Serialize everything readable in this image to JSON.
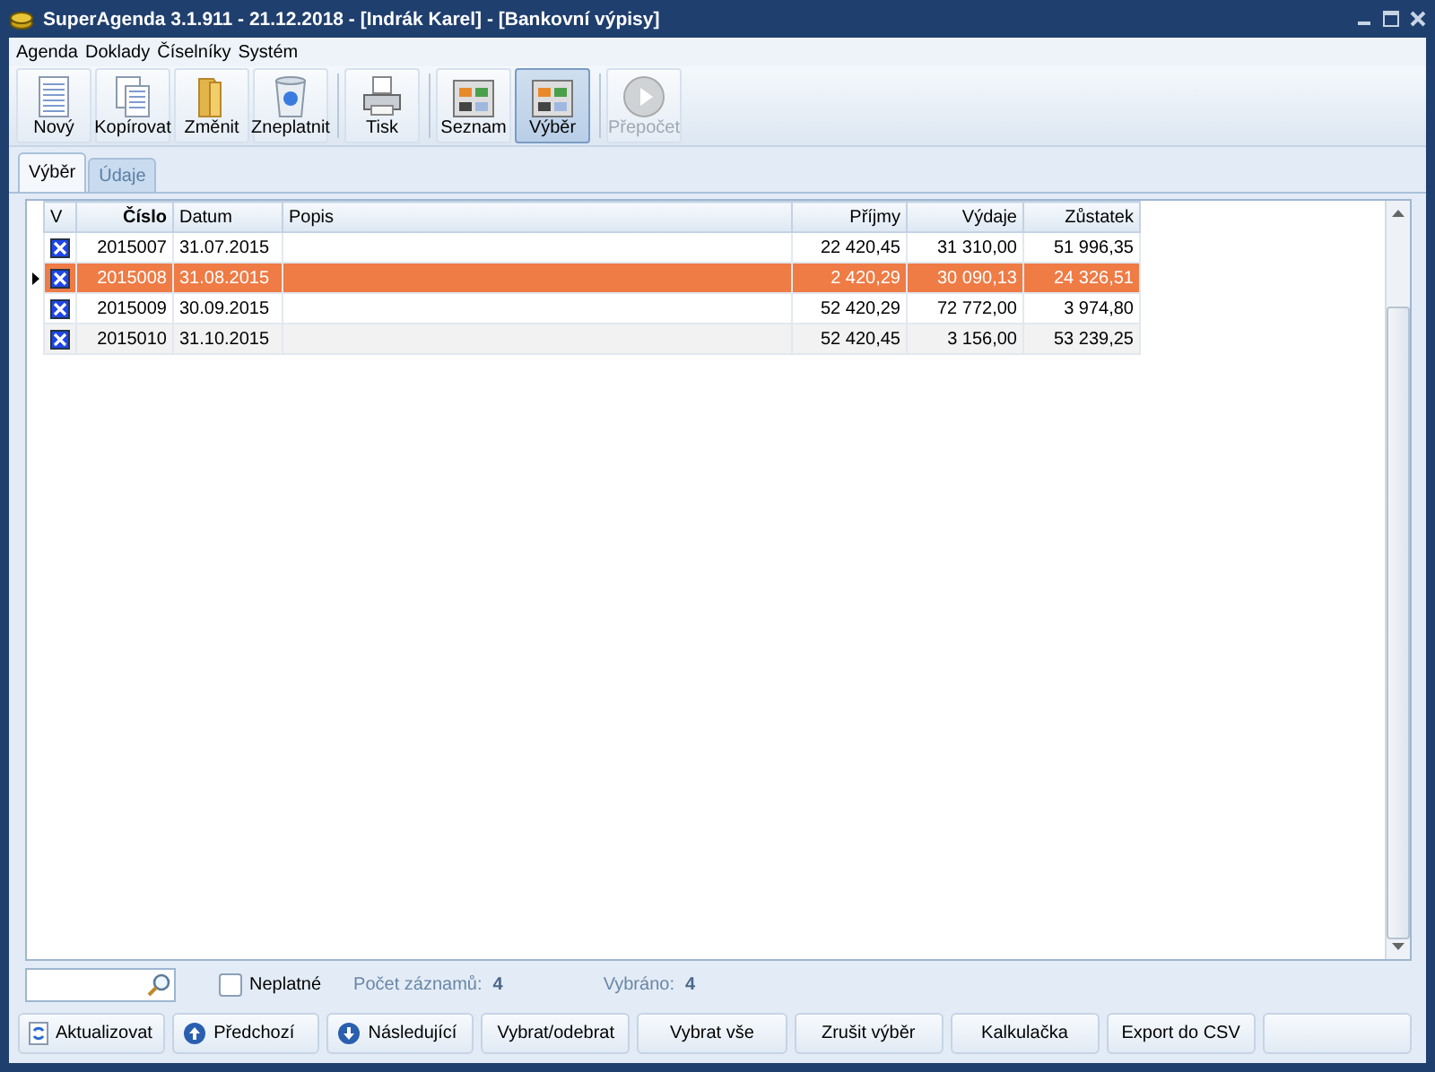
{
  "window": {
    "title": "SuperAgenda 3.1.911 - 21.12.2018 - [Indrák Karel] - [Bankovní výpisy]"
  },
  "menu": [
    "Agenda",
    "Doklady",
    "Číselníky",
    "Systém"
  ],
  "toolbar": [
    [
      {
        "label": "Nový",
        "kind": "new",
        "pressed": false,
        "disabled": false
      },
      {
        "label": "Kopírovat",
        "kind": "copy",
        "pressed": false,
        "disabled": false
      },
      {
        "label": "Změnit",
        "kind": "edit",
        "pressed": false,
        "disabled": false
      },
      {
        "label": "Zneplatnit",
        "kind": "trash",
        "pressed": false,
        "disabled": false
      }
    ],
    [
      {
        "label": "Tisk",
        "kind": "print",
        "pressed": false,
        "disabled": false
      }
    ],
    [
      {
        "label": "Seznam",
        "kind": "list",
        "pressed": false,
        "disabled": false
      },
      {
        "label": "Výběr",
        "kind": "list",
        "pressed": true,
        "disabled": false
      }
    ],
    [
      {
        "label": "Přepočet",
        "kind": "play",
        "pressed": false,
        "disabled": true
      }
    ]
  ],
  "tabs": [
    {
      "label": "Výběr",
      "selected": true
    },
    {
      "label": "Údaje",
      "selected": false
    }
  ],
  "table": {
    "check_column": "V",
    "columns": [
      "Číslo",
      "Datum",
      "Popis",
      "Příjmy",
      "Výdaje",
      "Zůstatek"
    ],
    "rows": [
      {
        "checked": true,
        "selected": false,
        "cells": [
          "2015007",
          "31.07.2015",
          "",
          "22 420,45",
          "31 310,00",
          "51 996,35"
        ]
      },
      {
        "checked": true,
        "selected": true,
        "cells": [
          "2015008",
          "31.08.2015",
          "",
          "2 420,29",
          "30 090,13",
          "24 326,51"
        ]
      },
      {
        "checked": true,
        "selected": false,
        "cells": [
          "2015009",
          "30.09.2015",
          "",
          "52 420,29",
          "72 772,00",
          "3 974,80"
        ]
      },
      {
        "checked": true,
        "selected": false,
        "cells": [
          "2015010",
          "31.10.2015",
          "",
          "52 420,45",
          "3 156,00",
          "53 239,25"
        ]
      }
    ]
  },
  "filter": {
    "invalid_label": "Neplatné",
    "invalid_checked": false,
    "count_label": "Počet záznamů:",
    "count": "4",
    "selected_label": "Vybráno:",
    "selected_count": "4"
  },
  "buttons": [
    {
      "label": "Aktualizovat",
      "kind": "refresh"
    },
    {
      "label": "Předchozí",
      "kind": "up"
    },
    {
      "label": "Následující",
      "kind": "down"
    },
    {
      "label": "Vybrat/odebrat",
      "kind": "plain"
    },
    {
      "label": "Vybrat vše",
      "kind": "plain"
    },
    {
      "label": "Zrušit výběr",
      "kind": "plain"
    },
    {
      "label": "Kalkulačka",
      "kind": "plain"
    },
    {
      "label": "Export do CSV",
      "kind": "plain"
    }
  ]
}
